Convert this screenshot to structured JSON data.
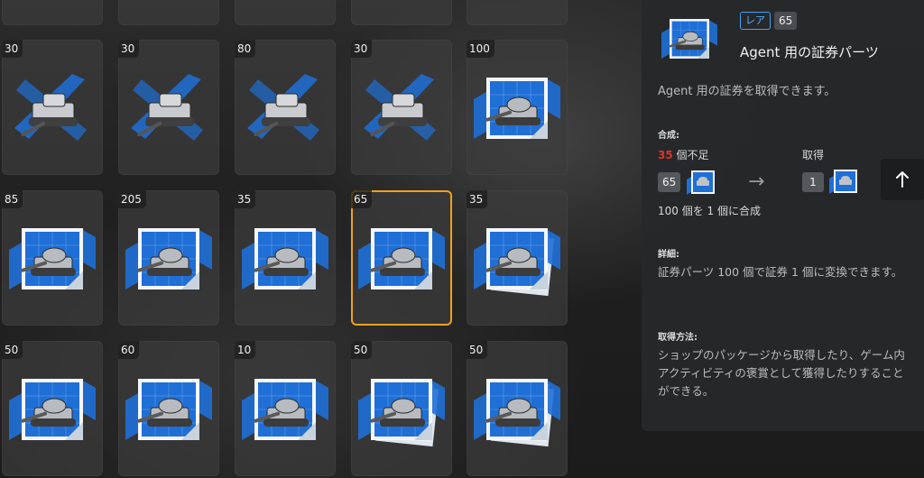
{
  "grid": {
    "top_row": [
      "",
      "",
      "",
      "",
      ""
    ],
    "rows": [
      [
        {
          "count": "30",
          "kind": "tank-parts"
        },
        {
          "count": "30",
          "kind": "tank-parts"
        },
        {
          "count": "80",
          "kind": "tank-parts"
        },
        {
          "count": "30",
          "kind": "tank-parts"
        },
        {
          "count": "100",
          "kind": "blueprint"
        }
      ],
      [
        {
          "count": "85",
          "kind": "blueprint"
        },
        {
          "count": "205",
          "kind": "blueprint"
        },
        {
          "count": "35",
          "kind": "blueprint"
        },
        {
          "count": "65",
          "kind": "blueprint",
          "selected": true
        },
        {
          "count": "35",
          "kind": "blueprint-stack"
        }
      ],
      [
        {
          "count": "50",
          "kind": "blueprint"
        },
        {
          "count": "60",
          "kind": "blueprint"
        },
        {
          "count": "10",
          "kind": "blueprint"
        },
        {
          "count": "50",
          "kind": "blueprint-stack"
        },
        {
          "count": "50",
          "kind": "blueprint-stack"
        }
      ]
    ]
  },
  "detail": {
    "rarity": "レア",
    "level": "65",
    "title": "Agent 用の証券パーツ",
    "description": "Agent 用の証券を取得できます。",
    "craft_label": "合成:",
    "shortage_count": "35",
    "shortage_text": " 個不足",
    "obtain_label": "取得",
    "input_count": "65",
    "output_count": "1",
    "arrow": "→",
    "ratio_text": "100 個を 1 個に合成",
    "details_label": "詳細:",
    "details_text": "証券パーツ 100 個で証券 1 個に変換できます。",
    "acquire_label": "取得方法:",
    "acquire_text": "ショップのパッケージから取得したり、ゲーム内アクティビティの褒賞として獲得したりすることができる。"
  },
  "colors": {
    "accent_selected": "#f0a020",
    "rarity_blue": "#3fa2ff",
    "shortage_red": "#e0322d",
    "blueprint_blue": "#1f6fd6"
  },
  "icons": [
    "tank-parts-icon",
    "blueprint-icon",
    "blueprint-stack-icon",
    "arrow-right-icon",
    "arrow-up-icon"
  ]
}
